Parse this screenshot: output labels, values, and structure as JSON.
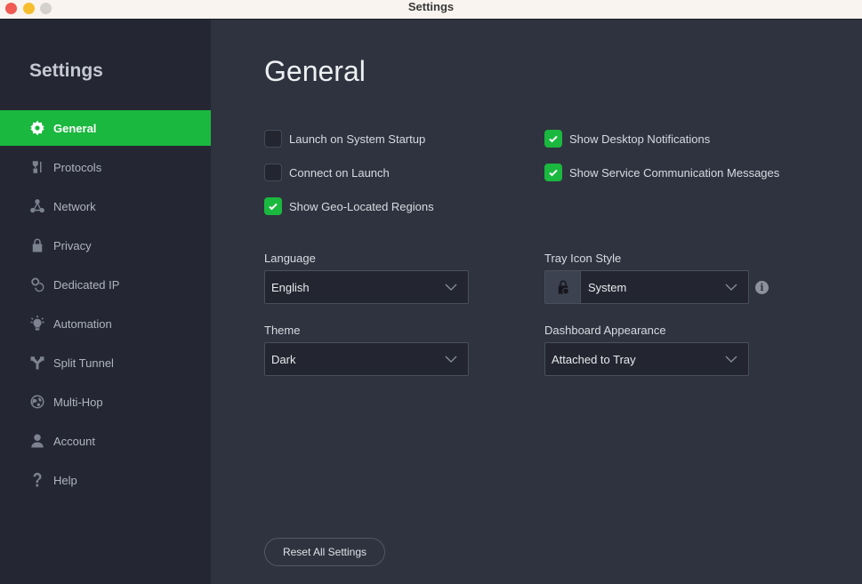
{
  "window": {
    "title": "Settings"
  },
  "sidebar": {
    "title": "Settings",
    "items": [
      {
        "label": "General",
        "icon": "gear-icon",
        "active": true
      },
      {
        "label": "Protocols",
        "icon": "protocols-icon",
        "active": false
      },
      {
        "label": "Network",
        "icon": "network-icon",
        "active": false
      },
      {
        "label": "Privacy",
        "icon": "lock-icon",
        "active": false
      },
      {
        "label": "Dedicated IP",
        "icon": "dedicated-ip-icon",
        "active": false
      },
      {
        "label": "Automation",
        "icon": "lightbulb-icon",
        "active": false
      },
      {
        "label": "Split Tunnel",
        "icon": "split-tunnel-icon",
        "active": false
      },
      {
        "label": "Multi-Hop",
        "icon": "globe-icon",
        "active": false
      },
      {
        "label": "Account",
        "icon": "user-icon",
        "active": false
      },
      {
        "label": "Help",
        "icon": "question-icon",
        "active": false
      }
    ]
  },
  "main": {
    "title": "General",
    "checkboxes": {
      "launch_on_startup": {
        "label": "Launch on System Startup",
        "checked": false
      },
      "connect_on_launch": {
        "label": "Connect on Launch",
        "checked": false
      },
      "show_geo_regions": {
        "label": "Show Geo-Located Regions",
        "checked": true
      },
      "show_desktop_notifications": {
        "label": "Show Desktop Notifications",
        "checked": true
      },
      "show_service_messages": {
        "label": "Show Service Communication Messages",
        "checked": true
      }
    },
    "language": {
      "label": "Language",
      "value": "English"
    },
    "theme": {
      "label": "Theme",
      "value": "Dark"
    },
    "tray_icon_style": {
      "label": "Tray Icon Style",
      "value": "System"
    },
    "dashboard_appearance": {
      "label": "Dashboard Appearance",
      "value": "Attached to Tray"
    },
    "reset_label": "Reset All Settings"
  },
  "colors": {
    "accent": "#1ab83e",
    "sidebar_bg": "#242733",
    "main_bg": "#2f333f"
  }
}
